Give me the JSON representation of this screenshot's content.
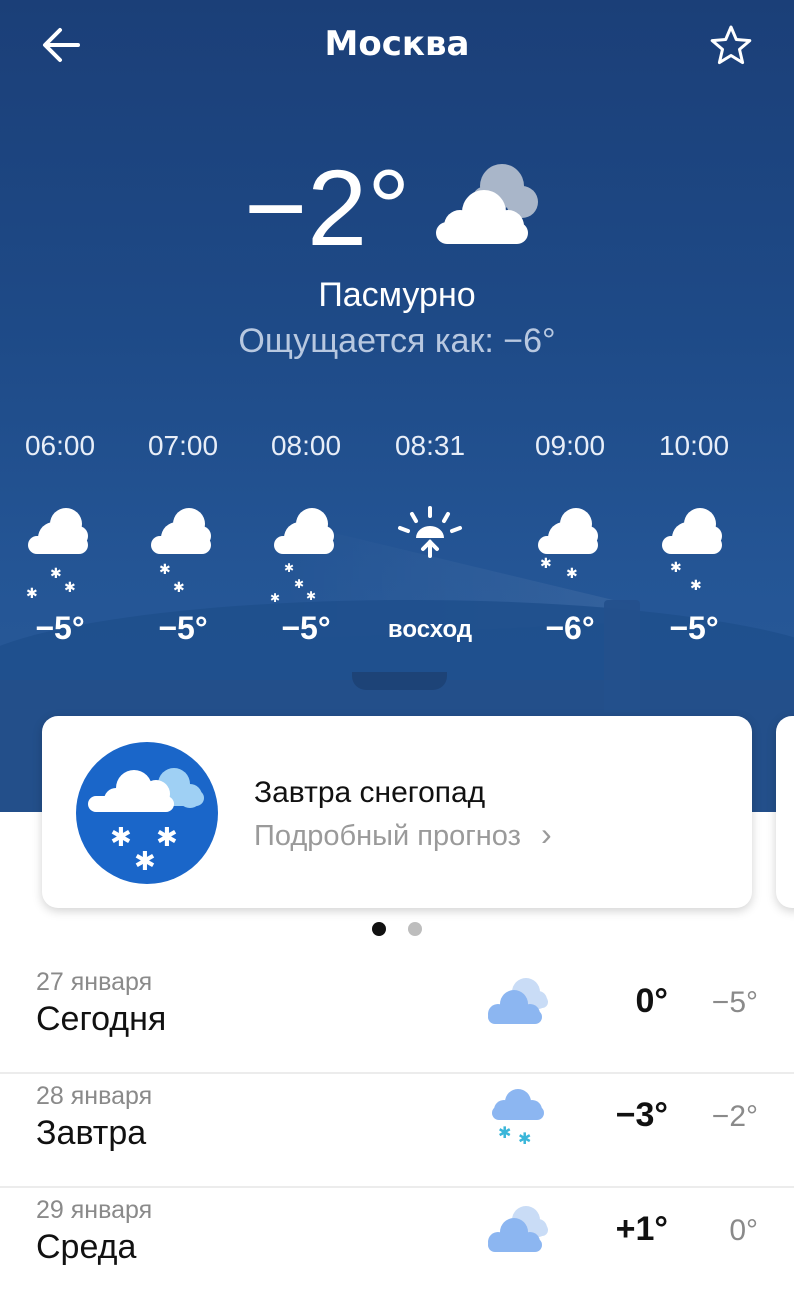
{
  "header": {
    "title": "Москва",
    "back_icon": "arrow-left-icon",
    "favorite_icon": "star-outline-icon"
  },
  "current": {
    "temperature": "−2°",
    "condition": "Пасмурно",
    "feels_like": "Ощущается как: −6°",
    "icon": "overcast-cloud-icon"
  },
  "hourly": [
    {
      "time": "06:00",
      "icon": "cloud-snow-icon",
      "value": "−5°"
    },
    {
      "time": "07:00",
      "icon": "cloud-snow-icon",
      "value": "−5°"
    },
    {
      "time": "08:00",
      "icon": "cloud-snow-icon",
      "value": "−5°"
    },
    {
      "time": "08:31",
      "icon": "sunrise-icon",
      "value": "восход"
    },
    {
      "time": "09:00",
      "icon": "cloud-snow-icon",
      "value": "−6°"
    },
    {
      "time": "10:00",
      "icon": "cloud-snow-icon",
      "value": "−5°"
    }
  ],
  "alert_card": {
    "title": "Завтра снегопад",
    "subtitle": "Подробный прогноз",
    "icon": "snowfall-icon",
    "chevron": "›",
    "page_indicator": {
      "count": 2,
      "active": 0
    }
  },
  "daily": [
    {
      "date": "27 января",
      "name": "Сегодня",
      "icon": "cloudy-icon",
      "high": "0°",
      "low": "−5°"
    },
    {
      "date": "28 января",
      "name": "Завтра",
      "icon": "cloud-snow-icon",
      "high": "−3°",
      "low": "−2°"
    },
    {
      "date": "29 января",
      "name": "Среда",
      "icon": "cloudy-icon",
      "high": "+1°",
      "low": "0°"
    }
  ],
  "colors": {
    "hero": "#1e4a87",
    "accent_blue": "#1a66c9",
    "snow_cyan": "#3ab6d9"
  }
}
